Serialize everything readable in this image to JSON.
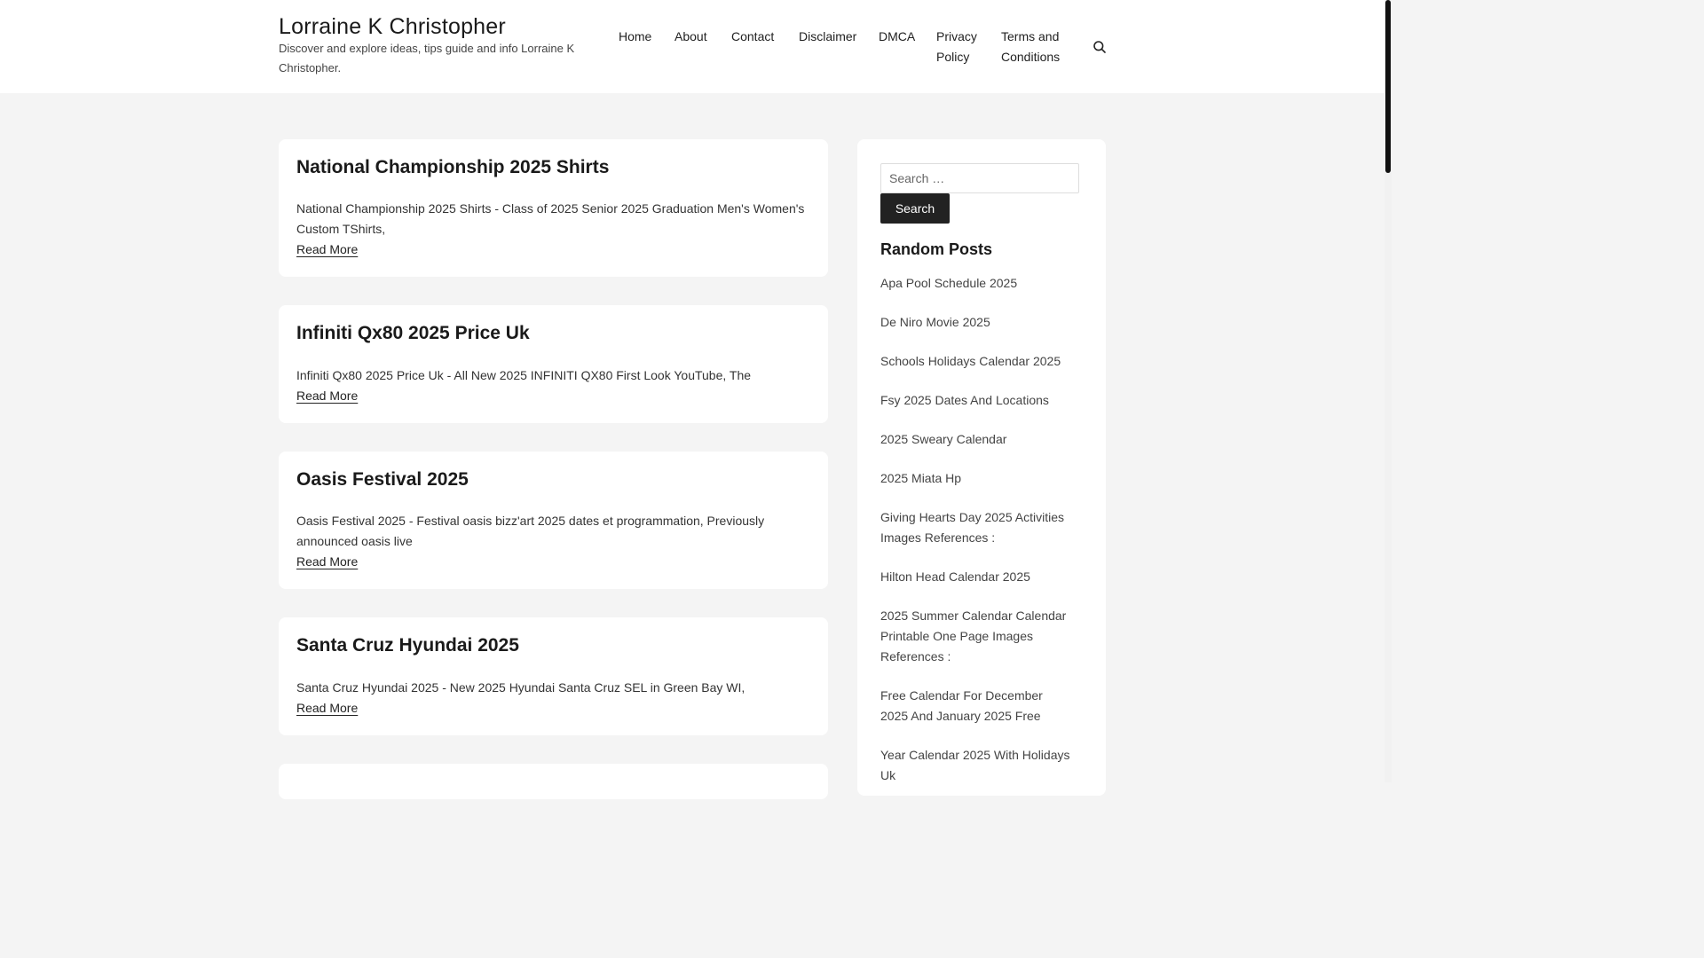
{
  "site": {
    "title": "Lorraine K Christopher",
    "description": "Discover and explore ideas, tips guide and info Lorraine K Christopher."
  },
  "nav": {
    "items": [
      "Home",
      "About",
      "Contact",
      "Disclaimer",
      "DMCA",
      "Privacy Policy",
      "Terms and Conditions"
    ],
    "search_icon": "search-icon"
  },
  "posts": [
    {
      "title": "National Championship 2025 Shirts",
      "excerpt": "National Championship 2025 Shirts - Class of 2025 Senior 2025 Graduation Men's Women's Custom TShirts,",
      "read_more": "Read More"
    },
    {
      "title": "Infiniti Qx80 2025 Price Uk",
      "excerpt": "Infiniti Qx80 2025 Price Uk - All New 2025 INFINITI QX80 First Look YouTube, The",
      "read_more": "Read More"
    },
    {
      "title": "Oasis Festival 2025",
      "excerpt": "Oasis Festival 2025 - Festival oasis bizz'art 2025 dates et programmation, Previously announced oasis live",
      "read_more": "Read More"
    },
    {
      "title": "Santa Cruz Hyundai 2025",
      "excerpt": "Santa Cruz Hyundai 2025 - New 2025 Hyundai Santa Cruz SEL in Green Bay WI,",
      "read_more": "Read More"
    }
  ],
  "sidebar": {
    "search_placeholder": "Search …",
    "search_button": "Search",
    "random_posts_title": "Random Posts",
    "random_posts": [
      "Apa Pool Schedule 2025",
      "De Niro Movie 2025",
      "Schools Holidays Calendar 2025",
      "Fsy 2025 Dates And Locations",
      "2025 Sweary Calendar",
      "2025 Miata Hp",
      "Giving Hearts Day 2025 Activities Images References :",
      "Hilton Head Calendar 2025",
      "2025 Summer Calendar Calendar Printable One Page Images References :",
      "Free Calendar For December 2025 And January 2025 Free",
      "Year Calendar 2025 With Holidays Uk"
    ]
  }
}
